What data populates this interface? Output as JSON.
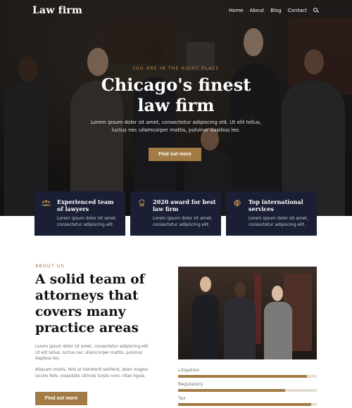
{
  "header": {
    "brand": "Law firm",
    "nav": [
      {
        "label": "Home"
      },
      {
        "label": "About"
      },
      {
        "label": "Blog"
      },
      {
        "label": "Contact"
      }
    ],
    "search_icon": "search-icon"
  },
  "hero": {
    "kicker": "YOU ARE IN THE RIGHT PLACE",
    "title_line1": "Chicago's finest",
    "title_line2": "law firm",
    "subtitle": "Lorem ipsum dolor sit amet, consectetur adipiscing elit. Ut elit tellus, luctus nec ullamcorper mattis, pulvinar dapibus leo.",
    "button": "Find out more"
  },
  "features": [
    {
      "icon": "team-icon",
      "title": "Experienced team of lawyers",
      "text": "Lorem ipsum dolor sit amet, consectetur adipiscing elit."
    },
    {
      "icon": "award-icon",
      "title": "2020 award for best law firm",
      "text": "Lorem ipsum dolor sit amet, consectetur adipiscing elit."
    },
    {
      "icon": "globe-icon",
      "title": "Top international services",
      "text": "Lorem ipsum dolor sit amet, consectetur adipiscing elit."
    }
  ],
  "about": {
    "kicker": "ABOUT US",
    "title": "A solid team of attorneys that covers many practice areas",
    "paragraph1": "Lorem ipsum dolor sit amet, consectetur adipiscing elit. Ut elit tellus, luctus nec ullamcorper mattis, pulvinar dapibus leo.",
    "paragraph2": "Aliquam mollis, felis at hendrerit eleifend, dolor magna iaculis felis, vulputate ultrices turpis nunc vitae ligula.",
    "button": "Find out more"
  },
  "skills": [
    {
      "label": "Litigation",
      "percent": 93
    },
    {
      "label": "Regulatory",
      "percent": 77
    },
    {
      "label": "Tax",
      "percent": 96
    }
  ],
  "colors": {
    "accent": "#a27b45",
    "card_bg": "#1a1f33"
  }
}
